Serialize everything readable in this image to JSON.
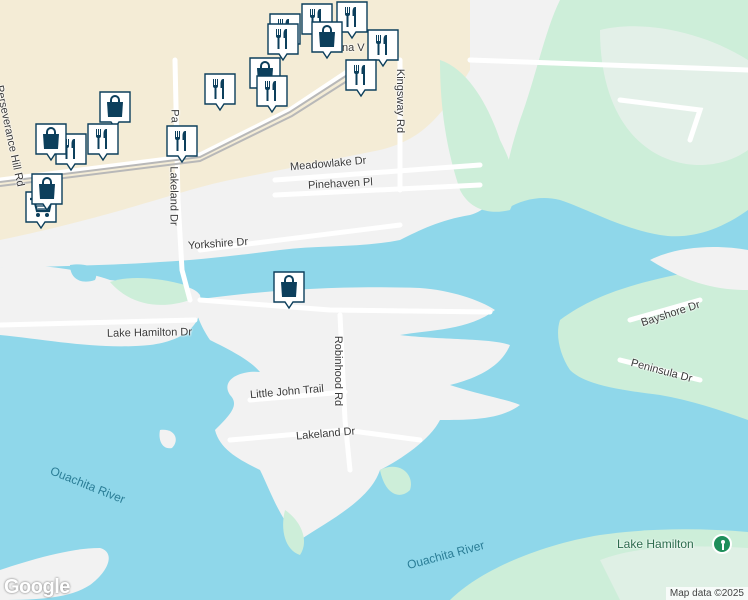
{
  "map": {
    "roads": [
      {
        "id": "meadowlake",
        "name": "Meadowlake Dr"
      },
      {
        "id": "pinehaven",
        "name": "Pinehaven Pl"
      },
      {
        "id": "yorkshire",
        "name": "Yorkshire Dr"
      },
      {
        "id": "lakehamilton",
        "name": "Lake Hamilton Dr"
      },
      {
        "id": "robinhood",
        "name": "Robinhood Rd"
      },
      {
        "id": "littlejohn",
        "name": "Little John Trail"
      },
      {
        "id": "lakeland_s",
        "name": "Lakeland Dr"
      },
      {
        "id": "lakeland_n",
        "name": "Lakeland Dr"
      },
      {
        "id": "kingsway",
        "name": "Kingsway Rd"
      },
      {
        "id": "bayshore",
        "name": "Bayshore Dr"
      },
      {
        "id": "peninsula",
        "name": "Peninsula Dr"
      },
      {
        "id": "perseverance",
        "name": "Perseverance Hill Rd"
      },
      {
        "id": "pa",
        "name": "Pa"
      },
      {
        "id": "nav",
        "name": "na V"
      }
    ],
    "water_labels": [
      {
        "id": "ouachita1",
        "name": "Ouachita River"
      },
      {
        "id": "ouachita2",
        "name": "Ouachita River"
      }
    ],
    "poi": {
      "name": "Lake Hamilton",
      "icon": "location-pin-icon"
    },
    "markers": [
      {
        "type": "restaurant",
        "icon": "fork-knife-icon"
      },
      {
        "type": "restaurant",
        "icon": "fork-knife-icon"
      },
      {
        "type": "restaurant",
        "icon": "fork-knife-icon"
      },
      {
        "type": "shopping",
        "icon": "shopping-bag-icon"
      },
      {
        "type": "restaurant",
        "icon": "fork-knife-icon"
      },
      {
        "type": "restaurant",
        "icon": "fork-knife-icon"
      },
      {
        "type": "restaurant",
        "icon": "fork-knife-icon"
      },
      {
        "type": "shopping",
        "icon": "shopping-bag-icon"
      },
      {
        "type": "restaurant",
        "icon": "fork-knife-icon"
      },
      {
        "type": "restaurant",
        "icon": "fork-knife-icon"
      },
      {
        "type": "shopping",
        "icon": "shopping-bag-icon"
      },
      {
        "type": "restaurant",
        "icon": "fork-knife-icon"
      },
      {
        "type": "restaurant",
        "icon": "fork-knife-icon"
      },
      {
        "type": "shopping",
        "icon": "shopping-bag-icon"
      },
      {
        "type": "restaurant",
        "icon": "fork-knife-icon"
      },
      {
        "type": "shopping",
        "icon": "shopping-bag-icon"
      },
      {
        "type": "grocery",
        "icon": "shopping-cart-icon"
      },
      {
        "type": "shopping",
        "icon": "shopping-bag-icon"
      }
    ],
    "colors": {
      "water": "#8fd7ea",
      "land": "#f2f2f2",
      "park": "#cdeed9",
      "urban": "#f4ecd6",
      "marker": "#0c3f5c"
    },
    "brand": "Google",
    "attribution": "Map data ©2025"
  }
}
